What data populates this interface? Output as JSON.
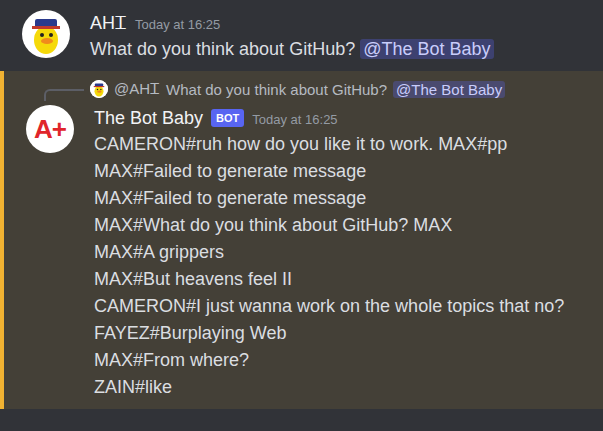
{
  "message": {
    "author": "AHᏆ",
    "timestamp": "Today at 16:25",
    "text": "What do you think about GitHub?",
    "mention": "@The Bot Baby"
  },
  "reply": {
    "highlighted": true,
    "reference": {
      "author": "@AHᏆ",
      "text": "What do you think about GitHub?",
      "mention": "@The Bot Baby"
    },
    "author": "The Bot Baby",
    "badge": "BOT",
    "timestamp": "Today at 16:25",
    "avatar_text": "A+",
    "lines": [
      "CAMERON#ruh how do you like it to work. MAX#pp",
      "MAX#Failed to generate message",
      "MAX#Failed to generate message",
      "MAX#What do you think about GitHub? MAX",
      "MAX#A grippers",
      "MAX#But heavens feel II",
      "CAMERON#I just wanna work on the whole topics that no?",
      "FAYEZ#Burplaying Web",
      "MAX#From where?",
      "ZAIN#like"
    ]
  }
}
